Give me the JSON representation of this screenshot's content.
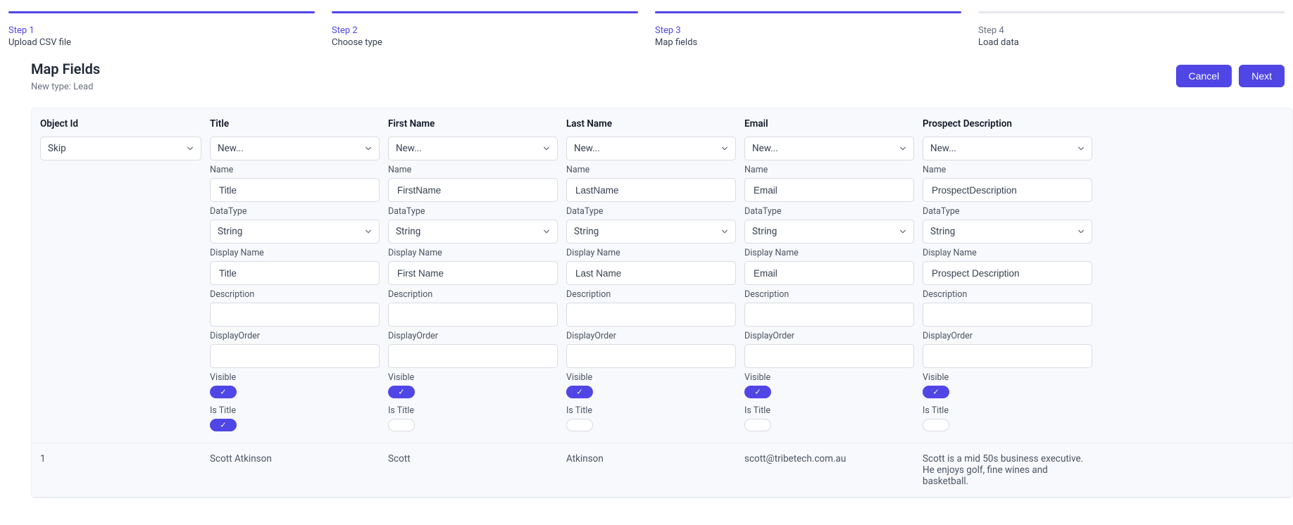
{
  "stepper": [
    {
      "num": "Step 1",
      "label": "Upload CSV file",
      "active": true
    },
    {
      "num": "Step 2",
      "label": "Choose type",
      "active": true
    },
    {
      "num": "Step 3",
      "label": "Map fields",
      "active": true
    },
    {
      "num": "Step 4",
      "label": "Load data",
      "active": false
    }
  ],
  "heading": {
    "title": "Map Fields",
    "subtitle": "New type: Lead"
  },
  "actions": {
    "cancel": "Cancel",
    "next": "Next"
  },
  "field_labels": {
    "name": "Name",
    "datatype": "DataType",
    "display_name": "Display Name",
    "description": "Description",
    "display_order": "DisplayOrder",
    "visible": "Visible",
    "is_title": "Is Title"
  },
  "columns": [
    {
      "header": "Object Id",
      "mapping": "Skip",
      "configurable": false
    },
    {
      "header": "Title",
      "mapping": "New...",
      "configurable": true,
      "name": "Title",
      "datatype": "String",
      "display_name": "Title",
      "description": "",
      "display_order": "",
      "visible": true,
      "is_title": true
    },
    {
      "header": "First Name",
      "mapping": "New...",
      "configurable": true,
      "name": "FirstName",
      "datatype": "String",
      "display_name": "First Name",
      "description": "",
      "display_order": "",
      "visible": true,
      "is_title": false
    },
    {
      "header": "Last Name",
      "mapping": "New...",
      "configurable": true,
      "name": "LastName",
      "datatype": "String",
      "display_name": "Last Name",
      "description": "",
      "display_order": "",
      "visible": true,
      "is_title": false
    },
    {
      "header": "Email",
      "mapping": "New...",
      "configurable": true,
      "name": "Email",
      "datatype": "String",
      "display_name": "Email",
      "description": "",
      "display_order": "",
      "visible": true,
      "is_title": false
    },
    {
      "header": "Prospect Description",
      "mapping": "New...",
      "configurable": true,
      "name": "ProspectDescription",
      "datatype": "String",
      "display_name": "Prospect Description",
      "description": "",
      "display_order": "",
      "visible": true,
      "is_title": false
    }
  ],
  "preview_row": [
    "1",
    "Scott Atkinson",
    "Scott",
    "Atkinson",
    "scott@tribetech.com.au",
    "Scott is a mid 50s business executive. He enjoys golf, fine wines and basketball."
  ]
}
